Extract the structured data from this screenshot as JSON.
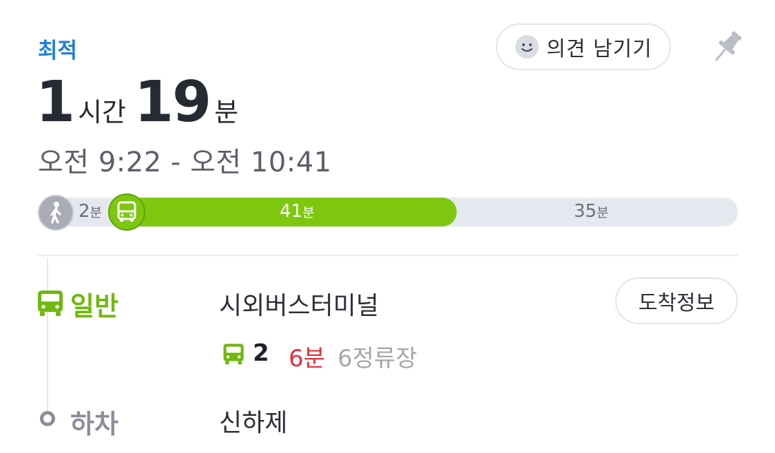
{
  "header": {
    "tag": "최적",
    "feedback_label": "의견 남기기",
    "icons": {
      "feedback": "smile-icon",
      "pin": "pin-icon"
    }
  },
  "duration": {
    "hours": "1",
    "hours_unit": "시간",
    "minutes": "19",
    "minutes_unit": "분"
  },
  "time_range": "오전 9:22 - 오전 10:41",
  "progress": {
    "segments": [
      {
        "mode": "walk",
        "minutes": "2",
        "unit": "분",
        "icon": "walk-icon",
        "color": "#a9acb7"
      },
      {
        "mode": "bus",
        "minutes": "41",
        "unit": "분",
        "icon": "bus-icon",
        "color": "#7dc80e"
      },
      {
        "mode": "walk",
        "minutes": "35",
        "unit": "분",
        "color": "#e6e8ef"
      }
    ]
  },
  "route": {
    "board": {
      "type": "일반",
      "stop": "시외버스터미널",
      "arrival_button": "도착정보",
      "bus_number": "2",
      "wait": "6분",
      "stop_count": "6정류장",
      "color": "#6fb80c"
    },
    "alight": {
      "type": "하차",
      "stop": "신하제"
    }
  },
  "colors": {
    "accent_blue": "#1d7ce0",
    "bus_green": "#7dc80e",
    "wait_red": "#e0303a"
  }
}
